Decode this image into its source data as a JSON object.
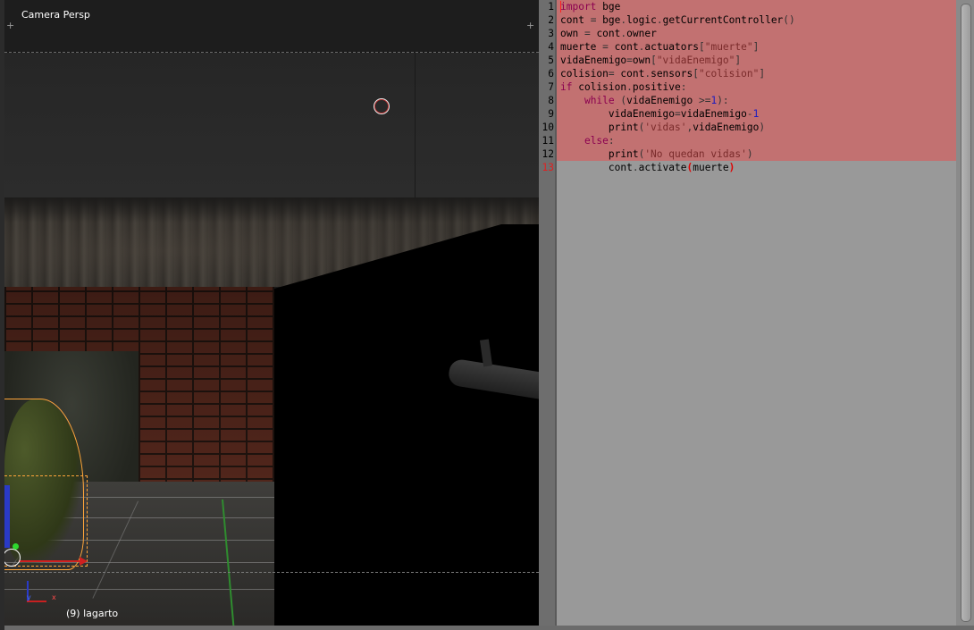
{
  "viewport": {
    "title": "Camera Persp",
    "object_label": "(9) lagarto",
    "gizmo": {
      "y": "y",
      "x": "x"
    }
  },
  "editor": {
    "line_numbers": [
      "1",
      "2",
      "3",
      "4",
      "5",
      "6",
      "7",
      "8",
      "9",
      "10",
      "11",
      "12",
      "13"
    ],
    "error_line": 13,
    "lines": [
      [
        {
          "t": "import",
          "c": "kw"
        },
        {
          "t": " bge",
          "c": ""
        }
      ],
      [
        {
          "t": "cont ",
          "c": ""
        },
        {
          "t": "=",
          "c": "op"
        },
        {
          "t": " bge",
          "c": ""
        },
        {
          "t": ".",
          "c": "op"
        },
        {
          "t": "logic",
          "c": ""
        },
        {
          "t": ".",
          "c": "op"
        },
        {
          "t": "getCurrentController",
          "c": ""
        },
        {
          "t": "()",
          "c": "op"
        }
      ],
      [
        {
          "t": "own ",
          "c": ""
        },
        {
          "t": "=",
          "c": "op"
        },
        {
          "t": " cont",
          "c": ""
        },
        {
          "t": ".",
          "c": "op"
        },
        {
          "t": "owner",
          "c": ""
        }
      ],
      [
        {
          "t": "muerte ",
          "c": ""
        },
        {
          "t": "=",
          "c": "op"
        },
        {
          "t": " cont",
          "c": ""
        },
        {
          "t": ".",
          "c": "op"
        },
        {
          "t": "actuators",
          "c": ""
        },
        {
          "t": "[",
          "c": "op"
        },
        {
          "t": "\"muerte\"",
          "c": "str"
        },
        {
          "t": "]",
          "c": "op"
        }
      ],
      [
        {
          "t": "vidaEnemigo",
          "c": ""
        },
        {
          "t": "=",
          "c": "op"
        },
        {
          "t": "own",
          "c": ""
        },
        {
          "t": "[",
          "c": "op"
        },
        {
          "t": "\"vidaEnemigo\"",
          "c": "str"
        },
        {
          "t": "]",
          "c": "op"
        }
      ],
      [
        {
          "t": "colision",
          "c": ""
        },
        {
          "t": "=",
          "c": "op"
        },
        {
          "t": " cont",
          "c": ""
        },
        {
          "t": ".",
          "c": "op"
        },
        {
          "t": "sensors",
          "c": ""
        },
        {
          "t": "[",
          "c": "op"
        },
        {
          "t": "\"colision\"",
          "c": "str"
        },
        {
          "t": "]",
          "c": "op"
        }
      ],
      [
        {
          "t": "if",
          "c": "kw"
        },
        {
          "t": " colision",
          "c": ""
        },
        {
          "t": ".",
          "c": "op"
        },
        {
          "t": "positive",
          "c": ""
        },
        {
          "t": ":",
          "c": "op"
        }
      ],
      [
        {
          "t": "    ",
          "c": ""
        },
        {
          "t": "while",
          "c": "kw"
        },
        {
          "t": " (",
          "c": "op"
        },
        {
          "t": "vidaEnemigo ",
          "c": ""
        },
        {
          "t": ">=",
          "c": "op"
        },
        {
          "t": "1",
          "c": "num"
        },
        {
          "t": "):",
          "c": "op"
        }
      ],
      [
        {
          "t": "        vidaEnemigo",
          "c": ""
        },
        {
          "t": "=",
          "c": "op"
        },
        {
          "t": "vidaEnemigo",
          "c": ""
        },
        {
          "t": "-",
          "c": "op"
        },
        {
          "t": "1",
          "c": "num"
        }
      ],
      [
        {
          "t": "        print",
          "c": ""
        },
        {
          "t": "(",
          "c": "op"
        },
        {
          "t": "'vidas'",
          "c": "str"
        },
        {
          "t": ",",
          "c": "op"
        },
        {
          "t": "vidaEnemigo",
          "c": ""
        },
        {
          "t": ")",
          "c": "op"
        }
      ],
      [
        {
          "t": "    ",
          "c": ""
        },
        {
          "t": "else",
          "c": "kw"
        },
        {
          "t": ":",
          "c": "op"
        }
      ],
      [
        {
          "t": "        print",
          "c": ""
        },
        {
          "t": "(",
          "c": "op"
        },
        {
          "t": "'No quedan vidas'",
          "c": "str"
        },
        {
          "t": ")",
          "c": "op"
        }
      ],
      [
        {
          "t": "        cont",
          "c": ""
        },
        {
          "t": ".",
          "c": "op"
        },
        {
          "t": "activate",
          "c": ""
        },
        {
          "t": "(",
          "c": "paren-err"
        },
        {
          "t": "muerte",
          "c": ""
        },
        {
          "t": ")",
          "c": "paren-err"
        }
      ]
    ]
  }
}
